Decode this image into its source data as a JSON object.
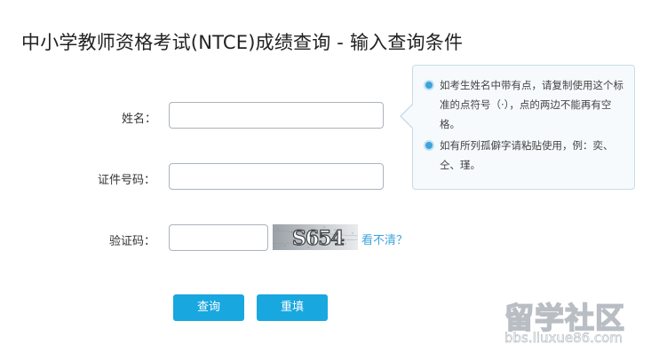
{
  "page": {
    "title": "中小学教师资格考试(NTCE)成绩查询 - 输入查询条件"
  },
  "form": {
    "name_label": "姓名：",
    "id_label": "证件号码：",
    "captcha_label": "验证码：",
    "name_value": "",
    "id_value": "",
    "captcha_value": "",
    "captcha_text": "S654",
    "refresh_link": "看不清？"
  },
  "buttons": {
    "query": "查询",
    "reset": "重填"
  },
  "tips": {
    "items": [
      "如考生姓名中带有点，请复制使用这个标准的点符号（·），点的两边不能再有空格。",
      "如有所列孤僻字请粘贴使用，例：奕、仝、瑾。"
    ]
  },
  "watermark": {
    "main": "留学社区",
    "sub": "bbs.liuxue86.com"
  },
  "colors": {
    "button": "#19a7e0",
    "link": "#3ea3dc",
    "tip_bullet": "#3ea3dc",
    "tip_border": "#c9dbe8"
  }
}
